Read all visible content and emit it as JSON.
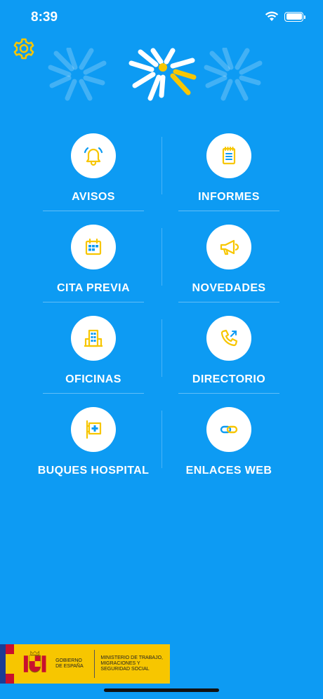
{
  "status_bar": {
    "time": "8:39"
  },
  "icons": {
    "settings": "gear-icon",
    "wifi": "wifi-icon",
    "battery": "battery-icon"
  },
  "colors": {
    "background": "#0d9bf3",
    "accent_yellow": "#f7c600",
    "icon_blue": "#0d9bf3"
  },
  "menu": {
    "items": [
      {
        "label": "AVISOS",
        "icon": "bell-icon"
      },
      {
        "label": "INFORMES",
        "icon": "notepad-icon"
      },
      {
        "label": "CITA PREVIA",
        "icon": "calendar-icon"
      },
      {
        "label": "NOVEDADES",
        "icon": "megaphone-icon"
      },
      {
        "label": "OFICINAS",
        "icon": "building-icon"
      },
      {
        "label": "DIRECTORIO",
        "icon": "phone-icon"
      },
      {
        "label": "BUQUES HOSPITAL",
        "icon": "hospital-flag-icon"
      },
      {
        "label": "ENLACES WEB",
        "icon": "link-icon"
      }
    ]
  },
  "footer": {
    "gobierno": "GOBIERNO DE ESPAÑA",
    "ministerio": "MINISTERIO DE TRABAJO, MIGRACIONES Y SEGURIDAD SOCIAL"
  }
}
